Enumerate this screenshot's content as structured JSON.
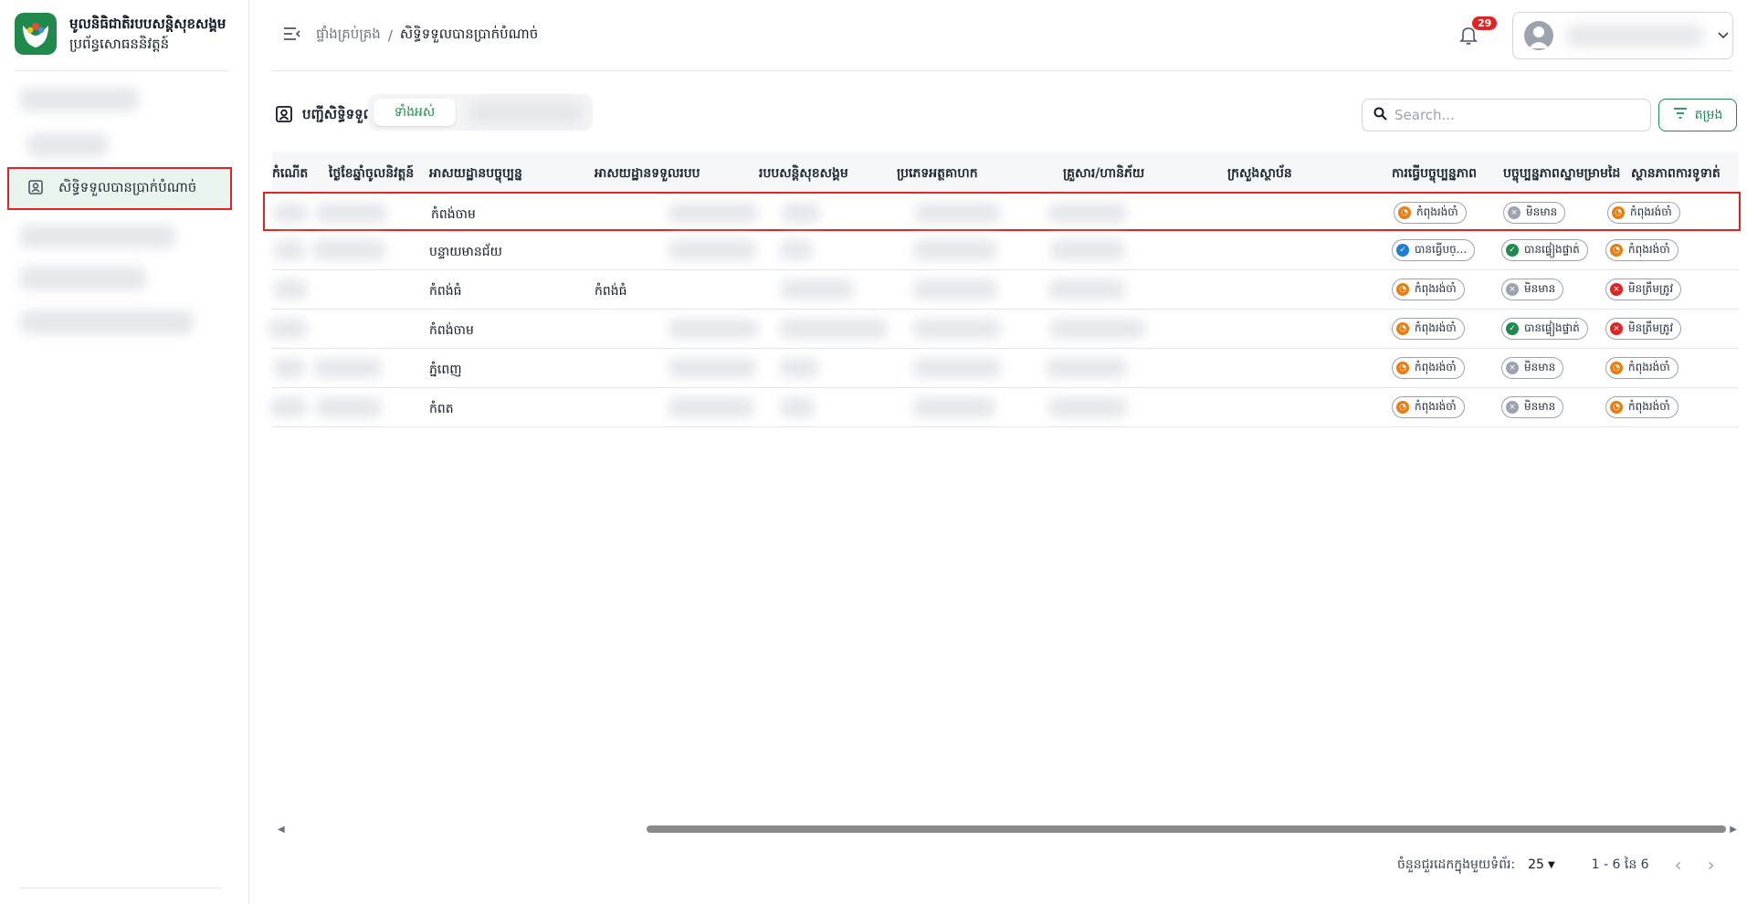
{
  "brand": {
    "title": "មូលនិធិជាតិរបបសន្តិសុខសង្គម",
    "subtitle": "ប្រព័ន្ធសោធននិវត្តន៍"
  },
  "sidebar": {
    "active_item": {
      "label": "សិទ្ធិទទួលបានប្រាក់បំណាច់",
      "icon": "contact-card-icon"
    }
  },
  "header": {
    "breadcrumb": {
      "home": "ផ្ទាំងគ្រប់គ្រង",
      "separator": "/",
      "current": "សិទ្ធិទទួលបានប្រាក់បំណាច់"
    },
    "notifications_count": "29"
  },
  "toolbar": {
    "title": "បញ្ជីសិទ្ធិទទួល",
    "tab_all": "ទាំងអស់",
    "search_placeholder": "Search...",
    "filter_label": "តម្រង"
  },
  "table": {
    "columns": [
      "កំណើត",
      "ថ្ងៃខែឆ្នាំចូលនិវត្តន៍",
      "អាសយដ្ឋានបច្ចុប្បន្ន",
      "អាសយដ្ឋានទទួលរបប",
      "របបសន្តិសុខសង្គម",
      "ប្រភេទអត្ថគាហក",
      "គ្រួសារ/ហានិភ័យ",
      "ក្រសួងស្ថាប័ន",
      "ការធ្វើបច្ចុប្បន្នភាព",
      "បច្ចុប្បន្នភាពស្នាមម្រាមដៃ",
      "ស្ថានភាពការទូទាត់"
    ],
    "rows": [
      {
        "current_address": "កំពង់ចាម",
        "benefit_address": "",
        "update": {
          "label": "កំពុងរង់ចាំ",
          "color": "orange"
        },
        "fingerprint": {
          "label": "មិនមាន",
          "color": "gray"
        },
        "payment": {
          "label": "កំពុងរង់ចាំ",
          "color": "orange"
        }
      },
      {
        "current_address": "បន្ទាយមានជ័យ",
        "benefit_address": "",
        "update": {
          "label": "បានធ្វើបច្...",
          "color": "blue"
        },
        "fingerprint": {
          "label": "បានផ្ទៀងផ្ទាត់",
          "color": "green"
        },
        "payment": {
          "label": "កំពុងរង់ចាំ",
          "color": "orange"
        }
      },
      {
        "current_address": "កំពង់ធំ",
        "benefit_address": "កំពង់ធំ",
        "update": {
          "label": "កំពុងរង់ចាំ",
          "color": "orange"
        },
        "fingerprint": {
          "label": "មិនមាន",
          "color": "gray"
        },
        "payment": {
          "label": "មិនត្រឹមត្រូវ",
          "color": "red"
        }
      },
      {
        "current_address": "កំពង់ចាម",
        "benefit_address": "",
        "update": {
          "label": "កំពុងរង់ចាំ",
          "color": "orange"
        },
        "fingerprint": {
          "label": "បានផ្ទៀងផ្ទាត់",
          "color": "green"
        },
        "payment": {
          "label": "មិនត្រឹមត្រូវ",
          "color": "red"
        }
      },
      {
        "current_address": "ភ្នំពេញ",
        "benefit_address": "",
        "update": {
          "label": "កំពុងរង់ចាំ",
          "color": "orange"
        },
        "fingerprint": {
          "label": "មិនមាន",
          "color": "gray"
        },
        "payment": {
          "label": "កំពុងរង់ចាំ",
          "color": "orange"
        }
      },
      {
        "current_address": "កំពត",
        "benefit_address": "",
        "update": {
          "label": "កំពុងរង់ចាំ",
          "color": "orange"
        },
        "fingerprint": {
          "label": "មិនមាន",
          "color": "gray"
        },
        "payment": {
          "label": "កំពុងរង់ចាំ",
          "color": "orange"
        }
      }
    ]
  },
  "pagination": {
    "rows_per_page_label": "ចំនួនជួរដេកក្នុងមួយទំព័រ:",
    "rows_per_page": "25",
    "range": "1 - 6 នៃ 6"
  },
  "colors": {
    "brand": "#1f8a4c",
    "danger": "#e02424",
    "warning": "#ea7c10",
    "info": "#1c7ed6"
  }
}
